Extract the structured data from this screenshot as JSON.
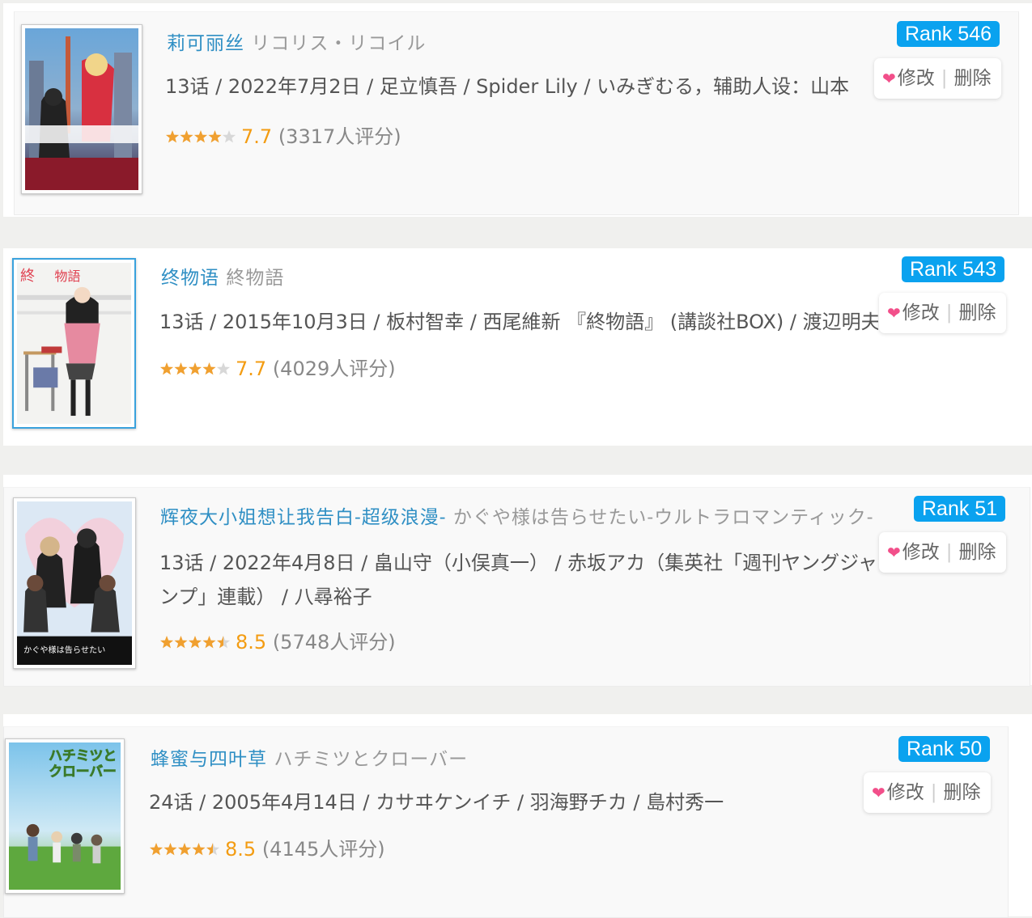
{
  "colors": {
    "title_link": "#2f8fc4",
    "rank_badge": "#0aa2ef",
    "score": "#f39c12",
    "heart": "#f24f8a",
    "star": "#f0a030"
  },
  "items": [
    {
      "title_cn": "莉可丽丝",
      "title_jp": "リコリス・リコイル",
      "info": "13话 / 2022年7月2日 / 足立慎吾 / Spider Lily / いみぎむる，辅助人设：山本",
      "score": "7.7",
      "votes": "(3317人评分)",
      "stars_value": 4,
      "rank": "Rank 546",
      "edit": "修改",
      "sep": "|",
      "delete": "删除",
      "heart_icon": "heart-icon"
    },
    {
      "title_cn": "终物语",
      "title_jp": "終物語",
      "info": "13话 / 2015年10月3日 / 板村智幸 / 西尾維新 『終物語』 (講談社BOX) / 渡辺明夫",
      "score": "7.7",
      "votes": "(4029人评分)",
      "stars_value": 4,
      "rank": "Rank 543",
      "edit": "修改",
      "sep": "|",
      "delete": "删除",
      "heart_icon": "heart-icon"
    },
    {
      "title_cn": "辉夜大小姐想让我告白-超级浪漫-",
      "title_jp": "かぐや様は告らせたい-ウルトラロマンティック-",
      "info": "13话 / 2022年4月8日 / 畠山守（小俣真一） / 赤坂アカ（集英社「週刊ヤングジャンプ」連載） / 八尋裕子",
      "score": "8.5",
      "votes": "(5748人评分)",
      "stars_value": 4.5,
      "rank": "Rank 51",
      "edit": "修改",
      "sep": "|",
      "delete": "删除",
      "heart_icon": "heart-icon"
    },
    {
      "title_cn": "蜂蜜与四叶草",
      "title_jp": "ハチミツとクローバー",
      "info": "24话 / 2005年4月14日 / カサヰケンイチ / 羽海野チカ / 島村秀一",
      "score": "8.5",
      "votes": "(4145人评分)",
      "stars_value": 4.5,
      "rank": "Rank 50",
      "edit": "修改",
      "sep": "|",
      "delete": "删除",
      "heart_icon": "heart-icon"
    }
  ]
}
